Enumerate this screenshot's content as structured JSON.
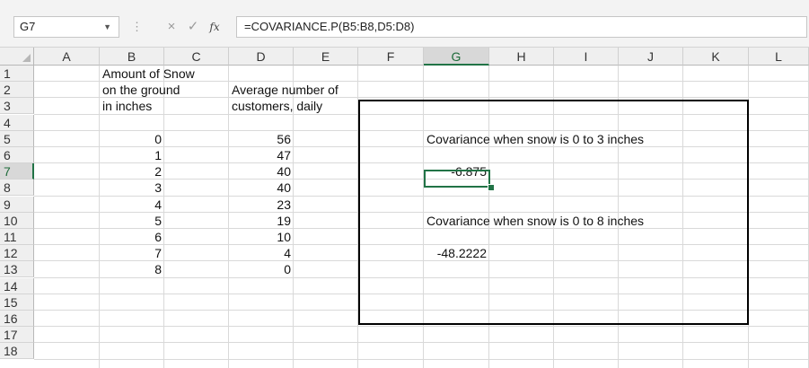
{
  "name_box": "G7",
  "formula": "=COVARIANCE.P(B5:B8,D5:D8)",
  "fx_label": "fx",
  "icons": {
    "cancel": "×",
    "enter": "✓",
    "more": "⋮",
    "dropdown": "▼"
  },
  "columns": [
    "A",
    "B",
    "C",
    "D",
    "E",
    "F",
    "G",
    "H",
    "I",
    "J",
    "K",
    "L"
  ],
  "rows": [
    "1",
    "2",
    "3",
    "4",
    "5",
    "6",
    "7",
    "8",
    "9",
    "10",
    "11",
    "12",
    "13",
    "14",
    "15",
    "16",
    "17",
    "18"
  ],
  "selected_column": "G",
  "selected_row": "7",
  "cells": {
    "B1": "Amount of Snow",
    "B2": "on the ground",
    "B3": "in inches",
    "D2": "Average number of",
    "D3": "customers, daily",
    "B5": "0",
    "B6": "1",
    "B7": "2",
    "B8": "3",
    "B9": "4",
    "B10": "5",
    "B11": "6",
    "B12": "7",
    "B13": "8",
    "D5": "56",
    "D6": "47",
    "D7": "40",
    "D8": "40",
    "D9": "23",
    "D10": "19",
    "D11": "10",
    "D12": "4",
    "D13": "0",
    "G5": "Covariance when snow is 0 to 3 inches",
    "G7": "-6.875",
    "G10": "Covariance when snow is 0 to 8 inches",
    "G12": "-48.2222"
  },
  "colors": {
    "excel_green": "#217346",
    "grid": "#d9d9d9",
    "header_bg": "#efefef"
  }
}
